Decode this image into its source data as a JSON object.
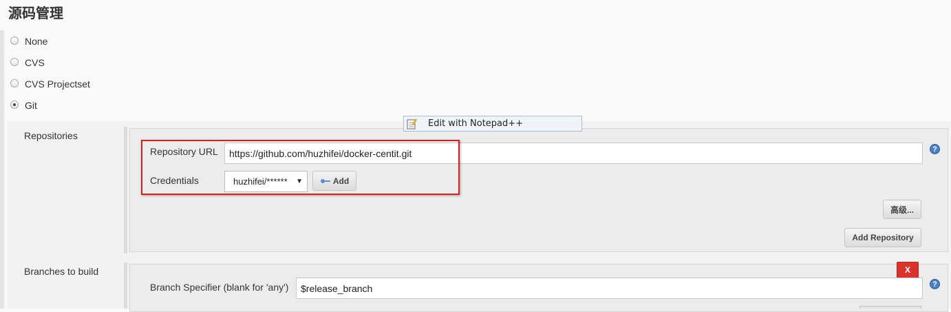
{
  "section": {
    "title": "源码管理"
  },
  "scm_options": [
    {
      "label": "None",
      "checked": false
    },
    {
      "label": "CVS",
      "checked": false
    },
    {
      "label": "CVS Projectset",
      "checked": false
    },
    {
      "label": "Git",
      "checked": true
    }
  ],
  "context_menu": {
    "label": "Edit with Notepad++"
  },
  "repositories": {
    "label": "Repositories",
    "url_label": "Repository URL",
    "url_value": "https://github.com/huzhifei/docker-centit.git",
    "credentials_label": "Credentials",
    "credentials_value": "huzhifei/******",
    "add_label": "Add",
    "advanced_label": "高级...",
    "add_repository_label": "Add Repository"
  },
  "branches": {
    "label": "Branches to build",
    "specifier_label": "Branch Specifier (blank for 'any')",
    "specifier_value": "$release_branch",
    "delete_label": "X"
  },
  "help_icon_text": "?",
  "colors": {
    "highlight_border": "#d42020",
    "delete": "#d9342b",
    "help": "#4a7fc1"
  }
}
